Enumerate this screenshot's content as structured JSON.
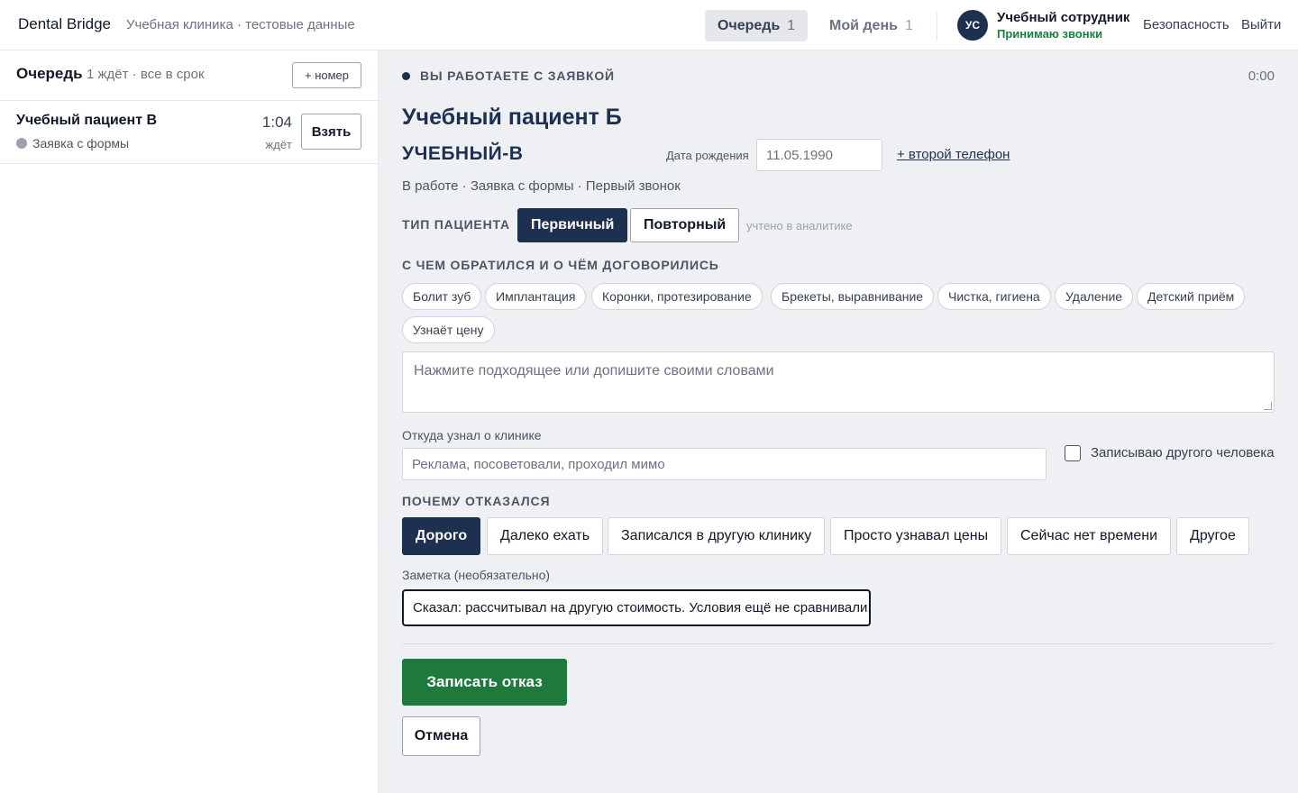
{
  "header": {
    "brand": "Dental Bridge",
    "clinic": "Учебная клиника · тестовые данные",
    "nav": [
      {
        "label": "Очередь",
        "count": "1"
      },
      {
        "label": "Мой день",
        "count": "1"
      }
    ],
    "user": {
      "initials": "УС",
      "name": "Учебный сотрудник",
      "status": "Принимаю звонки"
    },
    "links": {
      "security": "Безопасность",
      "logout": "Выйти"
    }
  },
  "sidebar": {
    "title": "Очередь",
    "meta": "1 ждёт · все в срок",
    "add_button": "+ номер",
    "items": [
      {
        "name": "Учебный пациент В",
        "source": "Заявка с формы",
        "time": "1:04",
        "wait_label": "ждёт",
        "take_button": "Взять"
      }
    ]
  },
  "main": {
    "work_label": "ВЫ РАБОТАЕТЕ С ЗАЯВКОЙ",
    "timer": "0:00",
    "patient_name": "Учебный пациент Б",
    "patient_code": "УЧЕБНЫЙ-В",
    "dob_label": "Дата рождения",
    "dob_value": "11.05.1990",
    "second_phone_link": "+ второй телефон",
    "status_line": "В работе · Заявка с формы · Первый звонок",
    "patient_type": {
      "label": "ТИП ПАЦИЕНТА",
      "options": [
        "Первичный",
        "Повторный"
      ],
      "selected": "Первичный",
      "note": "учтено в аналитике"
    },
    "topic": {
      "label": "С ЧЕМ ОБРАТИЛСЯ И О ЧЁМ ДОГОВОРИЛИСЬ",
      "chips": [
        "Болит зуб",
        "Имплантация",
        "Коронки, протезирование",
        "Брекеты, выравнивание",
        "Чистка, гигиена",
        "Удаление",
        "Детский приём",
        "Узнаёт цену"
      ],
      "placeholder": "Нажмите подходящее или допишите своими словами"
    },
    "source": {
      "label": "Откуда узнал о клинике",
      "placeholder": "Реклама, посоветовали, проходил мимо"
    },
    "other_person": {
      "label": "Записываю другого человека",
      "checked": false
    },
    "refusal": {
      "label": "ПОЧЕМУ ОТКАЗАЛСЯ",
      "options": [
        "Дорого",
        "Далеко ехать",
        "Записался в другую клинику",
        "Просто узнавал цены",
        "Сейчас нет времени",
        "Другое"
      ],
      "selected": "Дорого"
    },
    "note": {
      "label": "Заметка (необязательно)",
      "value": "Сказал: рассчитывал на другую стоимость. Условия ещё не сравнивали."
    },
    "submit_button": "Записать отказ",
    "cancel_button": "Отмена"
  },
  "colors": {
    "navy": "#1e3050",
    "green": "#1e7a3c",
    "status_green": "#16803c",
    "main_bg": "#eef0f3"
  }
}
